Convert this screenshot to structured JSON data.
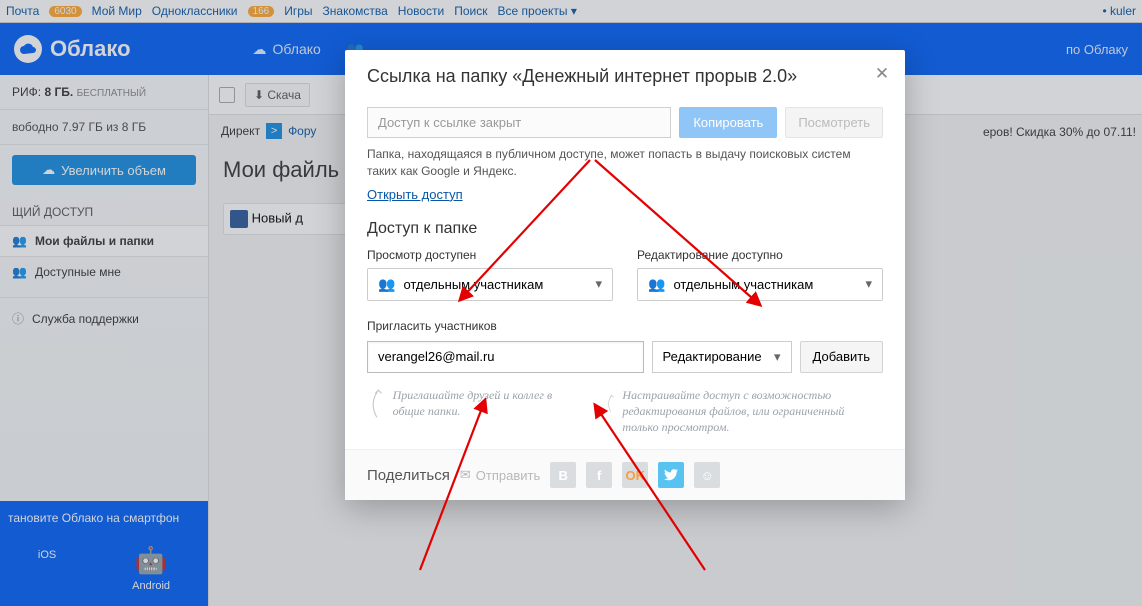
{
  "topnav": {
    "items": [
      "Почта",
      "Мой Мир",
      "Одноклассники",
      "Игры",
      "Знакомства",
      "Новости",
      "Поиск",
      "Все проекты"
    ],
    "badge_mail": "6030",
    "badge_ok": "166",
    "user": "kuler"
  },
  "header": {
    "logo": "Облако",
    "tab_cloud": "Облако",
    "search_hint": "по Облаку"
  },
  "sidebar": {
    "tariff_label": "РИФ:",
    "tariff_size": "8 ГБ.",
    "tariff_free": "БЕСПЛАТНЫЙ",
    "storage": "вободно 7.97 ГБ из 8 ГБ",
    "expand_btn": "Увеличить объем",
    "heading_shared": "ЩИЙ ДОСТУП",
    "item_myfiles": "Мои файлы и папки",
    "item_shared": "Доступные мне",
    "support": "Служба поддержки",
    "promo": "тановите Облако на смартфон",
    "ios": "iOS",
    "android": "Android"
  },
  "content": {
    "download": "Скача",
    "direkt": "Директ",
    "forum": "Фору",
    "page_title": "Мои файль",
    "file_new": "Новый д",
    "back_promo": "еров! Скидка 30% до 07.11!"
  },
  "modal": {
    "title": "Ссылка на папку «Денежный интернет прорыв 2.0»",
    "link_placeholder": "Доступ к ссылке закрыт",
    "copy": "Копировать",
    "view": "Посмотреть",
    "note": "Папка, находящаяся в публичном доступе, может попасть в выдачу поисковых систем таких как Google и Яндекс.",
    "open_access": "Открыть доступ",
    "access_heading": "Доступ к папке",
    "view_label": "Просмотр доступен",
    "edit_label": "Редактирование доступно",
    "select_participants": "отдельным участникам",
    "invite_label": "Пригласить участников",
    "email_value": "verangel26@mail.ru",
    "perm_edit": "Редактирование",
    "add_btn": "Добавить",
    "hint_left": "Приглашайте друзей и коллег в общие папки.",
    "hint_right": "Настраивайте доступ с возможностью редактирования файлов, или ограниченный только просмотром.",
    "share": "Поделиться",
    "send": "Отправить"
  }
}
